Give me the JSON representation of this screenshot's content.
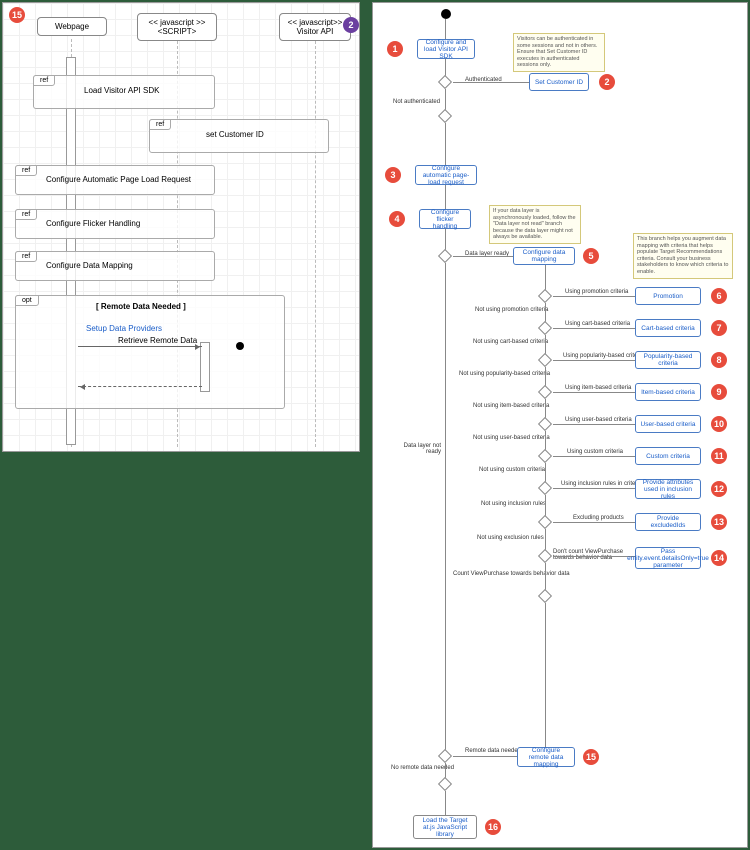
{
  "left": {
    "marker": "15",
    "lifelines": [
      {
        "label": "Webpage"
      },
      {
        "stereotype": "<< javascript >>",
        "label": "<SCRIPT>"
      },
      {
        "stereotype": "<< javascript>>",
        "label": "Visitor API"
      }
    ],
    "purple_marker": "2",
    "frames": [
      {
        "type": "ref",
        "label": "Load Visitor API SDK"
      },
      {
        "type": "ref",
        "label": "set Customer ID"
      },
      {
        "type": "ref",
        "label": "Configure Automatic Page Load Request"
      },
      {
        "type": "ref",
        "label": "Configure Flicker Handling"
      },
      {
        "type": "ref",
        "label": "Configure Data Mapping"
      },
      {
        "type": "opt",
        "guard": "[ Remote Data Needed ]",
        "link": "Setup Data Providers",
        "msg": "Retrieve Remote Data"
      }
    ]
  },
  "right": {
    "nodes": {
      "n1": {
        "num": "1",
        "label": "Configure and load Visitor API SDK"
      },
      "n2": {
        "num": "2",
        "label": "Set Customer ID"
      },
      "n3": {
        "num": "3",
        "label": "Configure automatic page-load request"
      },
      "n4": {
        "num": "4",
        "label": "Configure flicker handling"
      },
      "n5": {
        "num": "5",
        "label": "Configure data mapping"
      },
      "n6": {
        "num": "6",
        "label": "Promotion"
      },
      "n7": {
        "num": "7",
        "label": "Cart-based criteria"
      },
      "n8": {
        "num": "8",
        "label": "Popularity-based criteria"
      },
      "n9": {
        "num": "9",
        "label": "Item-based criteria"
      },
      "n10": {
        "num": "10",
        "label": "User-based criteria"
      },
      "n11": {
        "num": "11",
        "label": "Custom criteria"
      },
      "n12": {
        "num": "12",
        "label": "Provide attributes used in inclusion rules"
      },
      "n13": {
        "num": "13",
        "label": "Provide excludedIds"
      },
      "n14": {
        "num": "14",
        "label": "Pass entity.event.detailsOnly=true parameter"
      },
      "n15": {
        "num": "15",
        "label": "Configure remote data mapping"
      },
      "n16": {
        "num": "16",
        "label": "Load the Target at.js JavaScript library"
      }
    },
    "notes": {
      "note1": "Visitors can be authenticated in some sessions and not in others. Ensure that Set Customer ID executes in authenticated sessions only.",
      "note2": "If your data layer is asynchronously loaded, follow the \"Data layer not read\" branch because the data layer might not always be available.",
      "note3": "This branch helps you augment data mapping with criteria that helps populate Target Recommendations criteria. Consult your business stakeholders to know which criteria to enable."
    },
    "labels": {
      "auth": "Authenticated",
      "notauth": "Not authenticated",
      "dlready": "Data layer ready",
      "dlnotready": "Data layer not ready",
      "usepromo": "Using promotion criteria",
      "nopromo": "Not using promotion criteria",
      "usecart": "Using cart-based criteria",
      "nocart": "Not using cart-based criteria",
      "usepop": "Using popularity-based criteria",
      "nopop": "Not using popularity-based criteria",
      "useitem": "Using item-based criteria",
      "noitem": "Not using item-based criteria",
      "useuser": "Using user-based criteria",
      "nouser": "Not using user-based criteria",
      "usecustom": "Using custom criteria",
      "nocustom": "Not using custom criteria",
      "useincl": "Using inclusion rules in criteria",
      "noincl": "Not using inclusion rules",
      "excl": "Excluding products",
      "noexcl": "Not using exclusion rules",
      "nocount": "Don't count ViewPurchase towards behavior data",
      "count": "Count ViewPurchase towards behavior data",
      "remote": "Remote data needed",
      "noremote": "No remote data needed"
    }
  }
}
